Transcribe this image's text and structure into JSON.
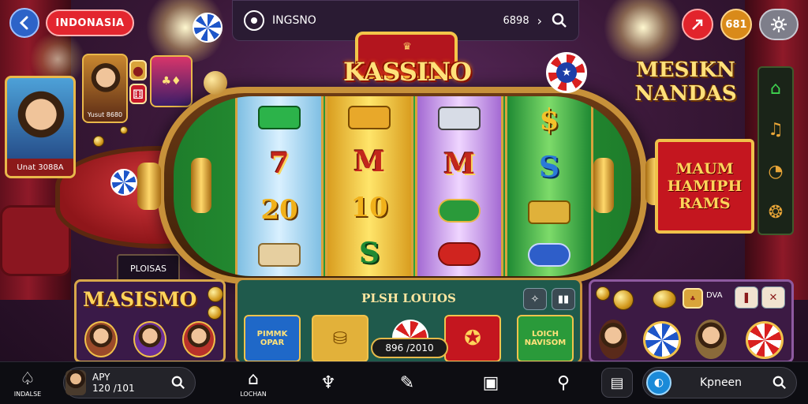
{
  "header": {
    "region": "INDONASIA",
    "search_label": "INGSNO",
    "search_count": "6898",
    "badge_2": "681"
  },
  "logo": {
    "title": "KASSINO"
  },
  "left_card": {
    "caption": "Unat 3088A"
  },
  "small_card": {
    "caption": "Yusut 8680"
  },
  "table_sign": "PLOISAS",
  "reels": [
    [
      "7",
      "20"
    ],
    [
      "M",
      "10"
    ],
    [
      "M"
    ],
    [
      "S"
    ]
  ],
  "right_signs": {
    "sign_1_line1": "MESIKN",
    "sign_1_line2": "NANDAS",
    "sign_2": "MAUM HAMIPH RAMS"
  },
  "panels": {
    "left_title": "MASISMO",
    "center_title": "PLSH LOUIOS",
    "tile_1": "PIMMK OPAR",
    "tile_4": "LOICH NAVISOM",
    "jackpot": "896 /2010",
    "right_label": "DVA"
  },
  "bottom_nav": {
    "home_label": "INDALSE",
    "profile_line1": "APY",
    "profile_line2": "120 /101",
    "lobby_label": "LOCHAN",
    "search_text": "Kpneen"
  },
  "colors": {
    "accent_red": "#e3262f",
    "gold": "#e9b84a",
    "felt_green": "#2da53c",
    "blue": "#2d63c8"
  }
}
